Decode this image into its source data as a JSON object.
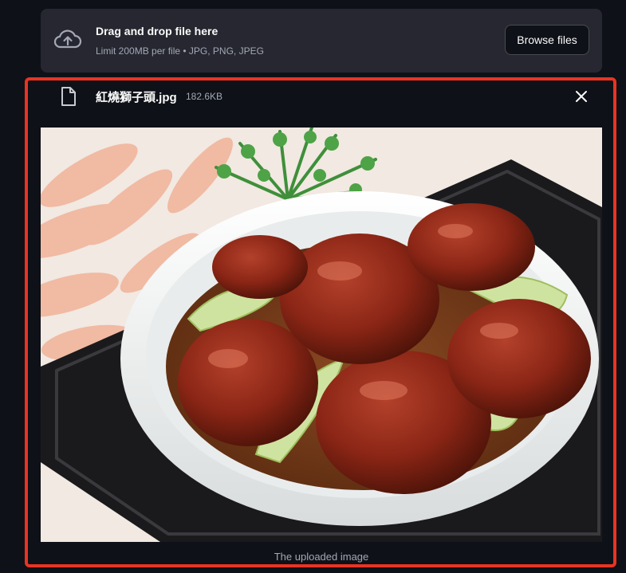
{
  "uploader": {
    "title": "Drag and drop file here",
    "limit_text": "Limit 200MB per file • JPG, PNG, JPEG",
    "browse_label": "Browse files",
    "upload_icon": "cloud-upload-icon"
  },
  "file": {
    "name": "紅燒獅子頭.jpg",
    "size": "182.6KB",
    "icon": "file-icon",
    "remove_icon": "close-icon"
  },
  "image": {
    "caption": "The uploaded image"
  },
  "colors": {
    "background": "#0e1117",
    "dropzone": "#262730",
    "highlight_border": "#ea3323",
    "muted_text": "#a3a8b4"
  }
}
